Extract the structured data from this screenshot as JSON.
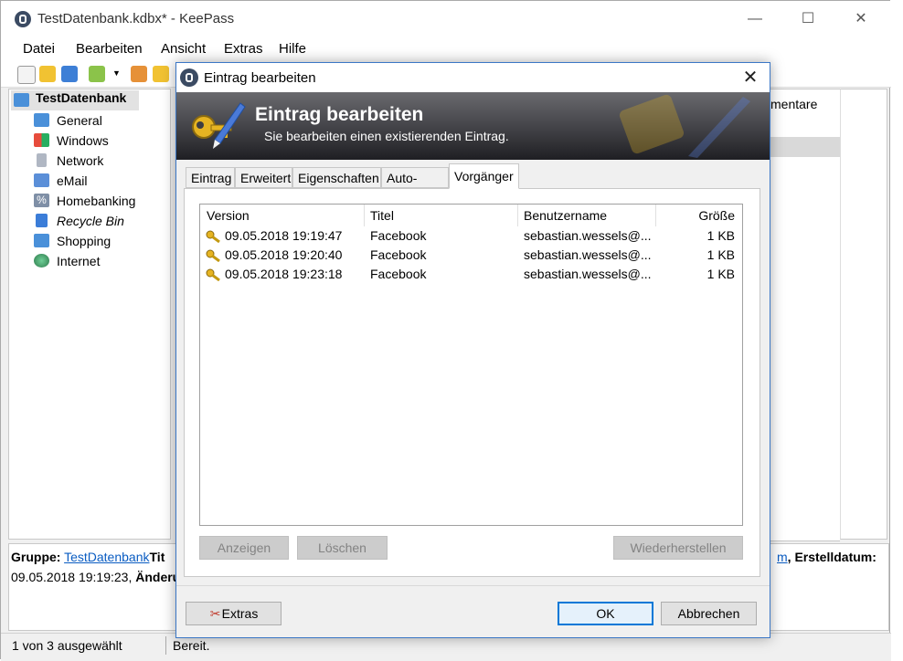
{
  "main": {
    "title": "TestDatenbank.kdbx* - KeePass",
    "menu": [
      "Datei",
      "Bearbeiten",
      "Ansicht",
      "Extras",
      "Hilfe"
    ],
    "window_controls": {
      "minimize": "—",
      "maximize": "☐",
      "close": "✕"
    }
  },
  "tree": {
    "root": "TestDatenbank",
    "items": [
      "General",
      "Windows",
      "Network",
      "eMail",
      "Homebanking",
      "Recycle Bin",
      "Shopping",
      "Internet"
    ]
  },
  "rightlist": {
    "header_fragment": "mentare"
  },
  "info": {
    "label_group": "Gruppe:",
    "group_link": "TestDatenbank",
    "title_fragment": "Tit",
    "link_fragment": "m",
    "label_created": ", Erstelldatum:",
    "line2_date": "09.05.2018 19:19:23,",
    "line2_label": "Änderu"
  },
  "status": {
    "selection": "1 von 3 ausgewählt",
    "state": "Bereit."
  },
  "dialog": {
    "title": "Eintrag bearbeiten",
    "banner_heading": "Eintrag bearbeiten",
    "banner_sub": "Sie bearbeiten einen existierenden Eintrag.",
    "tabs": [
      "Eintrag",
      "Erweitert",
      "Eigenschaften",
      "Auto-Type",
      "Vorgänger"
    ],
    "active_tab": "Vorgänger",
    "columns": [
      "Version",
      "Titel",
      "Benutzername",
      "Größe"
    ],
    "rows": [
      {
        "version": "09.05.2018 19:19:47",
        "title": "Facebook",
        "user": "sebastian.wessels@...",
        "size": "1 KB"
      },
      {
        "version": "09.05.2018 19:20:40",
        "title": "Facebook",
        "user": "sebastian.wessels@...",
        "size": "1 KB"
      },
      {
        "version": "09.05.2018 19:23:18",
        "title": "Facebook",
        "user": "sebastian.wessels@...",
        "size": "1 KB"
      }
    ],
    "buttons": {
      "view": "Anzeigen",
      "delete": "Löschen",
      "restore": "Wiederherstellen",
      "extras": "Extras",
      "ok": "OK",
      "cancel": "Abbrechen"
    },
    "colors": {
      "accent": "#0078d7",
      "banner_dark": "#2a2a2e",
      "key_gold": "#e6b422"
    }
  }
}
